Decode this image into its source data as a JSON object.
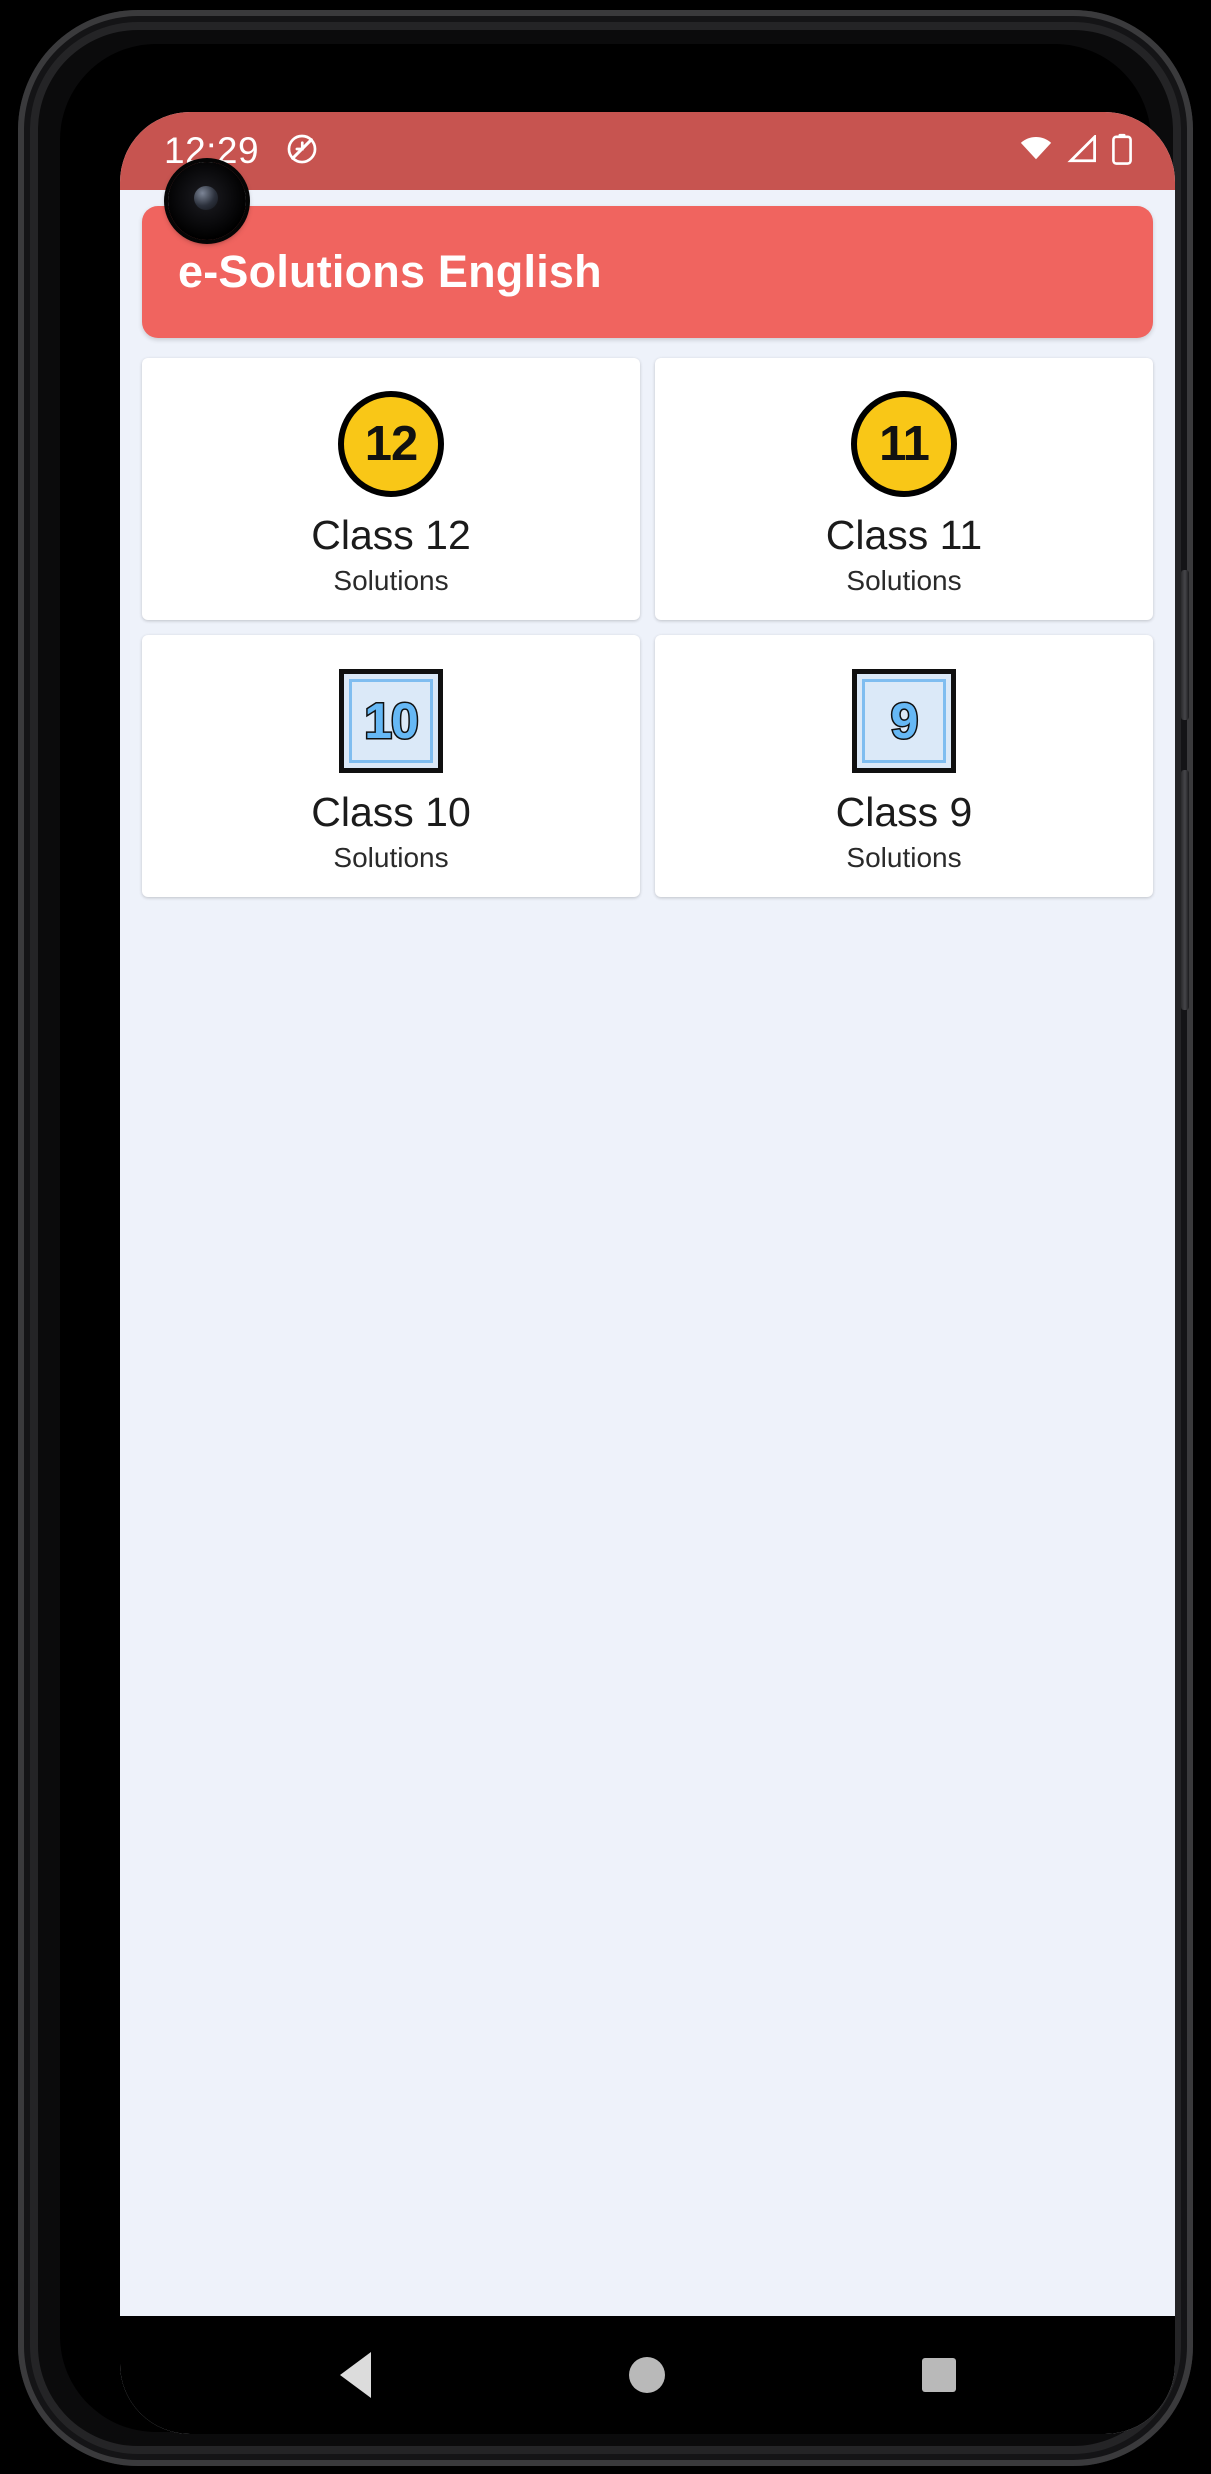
{
  "statusbar": {
    "time": "12:29",
    "icons_left": [
      "auto-rotate-off-icon"
    ],
    "icons_right": [
      "wifi-icon",
      "cellular-signal-icon",
      "battery-icon"
    ]
  },
  "appbar": {
    "title": "e-Solutions English"
  },
  "colors": {
    "statusbar_bg": "#c75450",
    "appbar_bg": "#f0645f",
    "page_bg": "#eef2fa",
    "card_bg": "#ffffff",
    "badge_circle_fill": "#f9c717",
    "badge_square_fill": "#dbe9f8",
    "badge_square_digit": "#66b8f5",
    "navbar_bg": "#000000"
  },
  "cards": [
    {
      "badge": "12",
      "badge_style": "circle",
      "title": "Class 12",
      "subtitle": "Solutions"
    },
    {
      "badge": "11",
      "badge_style": "circle",
      "title": "Class 11",
      "subtitle": "Solutions"
    },
    {
      "badge": "10",
      "badge_style": "square",
      "title": "Class 10",
      "subtitle": "Solutions"
    },
    {
      "badge": "9",
      "badge_style": "square",
      "title": "Class 9",
      "subtitle": "Solutions"
    }
  ],
  "navbar": {
    "back_label": "Back",
    "home_label": "Home",
    "recents_label": "Recent apps"
  }
}
